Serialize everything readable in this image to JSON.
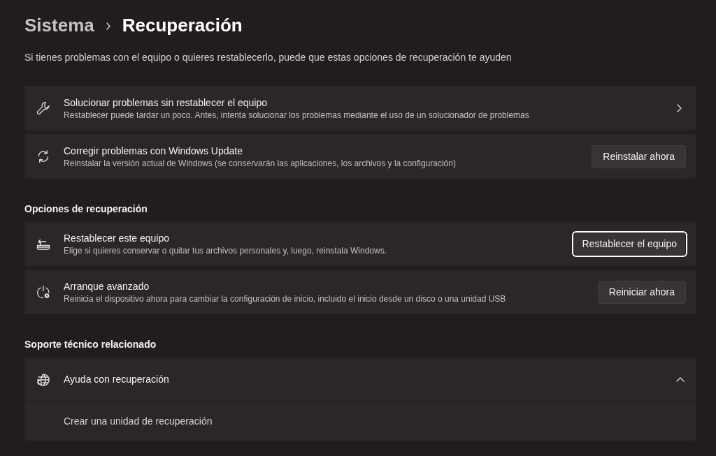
{
  "breadcrumb": [
    {
      "label": "Sistema",
      "current": false
    },
    {
      "label": "Recuperación",
      "current": true
    }
  ],
  "description": "Si tienes problemas con el equipo o quieres restablecerlo, puede que estas opciones de recuperación te ayuden",
  "top_cards": [
    {
      "title": "Solucionar problemas sin restablecer el equipo",
      "subtitle": "Restablecer puede tardar un poco. Antes, intenta solucionar los problemas mediante el uso de un solucionador de problemas",
      "action": {
        "kind": "chevron"
      }
    },
    {
      "title": "Corregir problemas con Windows Update",
      "subtitle": "Reinstalar la versión actual de Windows (se conservarán las aplicaciones, los archivos y la configuración)",
      "action": {
        "kind": "button",
        "label": "Reinstalar ahora",
        "focused": false
      }
    }
  ],
  "recovery_options": {
    "heading": "Opciones de recuperación",
    "items": [
      {
        "title": "Restablecer este equipo",
        "subtitle": "Elige si quieres conservar o quitar tus archivos personales y, luego, reinstala Windows.",
        "action": {
          "kind": "button",
          "label": "Restablecer el equipo",
          "focused": true
        }
      },
      {
        "title": "Arranque avanzado",
        "subtitle": "Reinicia el dispositivo ahora para cambiar la configuración de inicio, incluido el inicio desde un disco o una unidad USB",
        "action": {
          "kind": "button",
          "label": "Reiniciar ahora",
          "focused": false
        }
      }
    ]
  },
  "related_support": {
    "heading": "Soporte técnico relacionado",
    "expander": {
      "title": "Ayuda con recuperación",
      "expanded": true,
      "links": [
        "Crear una unidad de recuperación"
      ]
    }
  }
}
